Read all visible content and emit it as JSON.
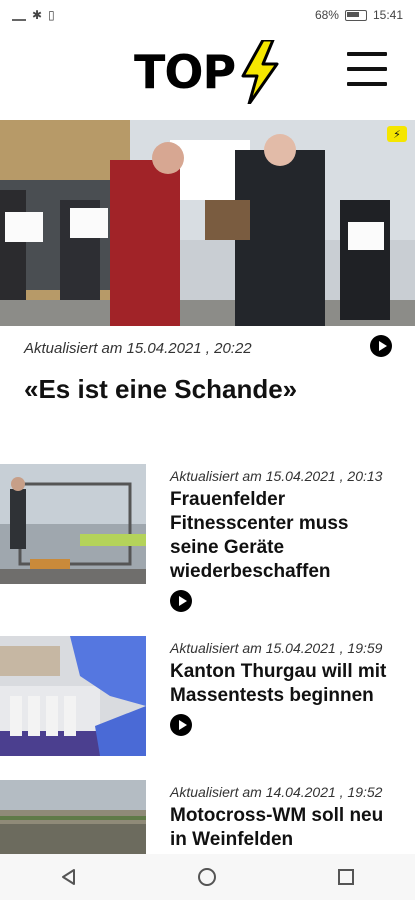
{
  "status": {
    "battery": "68%",
    "time": "15:41"
  },
  "header": {
    "logo_text": "TOP",
    "logo_icon": "lightning-bolt-icon",
    "menu_icon": "hamburger-menu-icon"
  },
  "hero": {
    "badge_icon": "lightning-bolt-icon",
    "meta": "Aktualisiert am 15.04.2021 , 20:22",
    "title": "«Es ist eine Schande»",
    "has_video": true
  },
  "articles": [
    {
      "meta": "Aktualisiert am 15.04.2021 , 20:13",
      "title": "Frauenfelder Fitnesscenter muss seine Geräte wiederbeschaffen",
      "has_video": true
    },
    {
      "meta": "Aktualisiert am 15.04.2021 , 19:59",
      "title": "Kanton Thurgau will mit Massentests beginnen",
      "has_video": true
    },
    {
      "meta": "Aktualisiert am 14.04.2021 , 19:52",
      "title": "Motocross-WM soll neu in Weinfelden",
      "has_video": false
    }
  ],
  "navbar": {
    "back_icon": "back-triangle-icon",
    "home_icon": "home-circle-icon",
    "recents_icon": "recents-square-icon"
  },
  "colors": {
    "accent": "#f5e600",
    "text": "#111111"
  }
}
